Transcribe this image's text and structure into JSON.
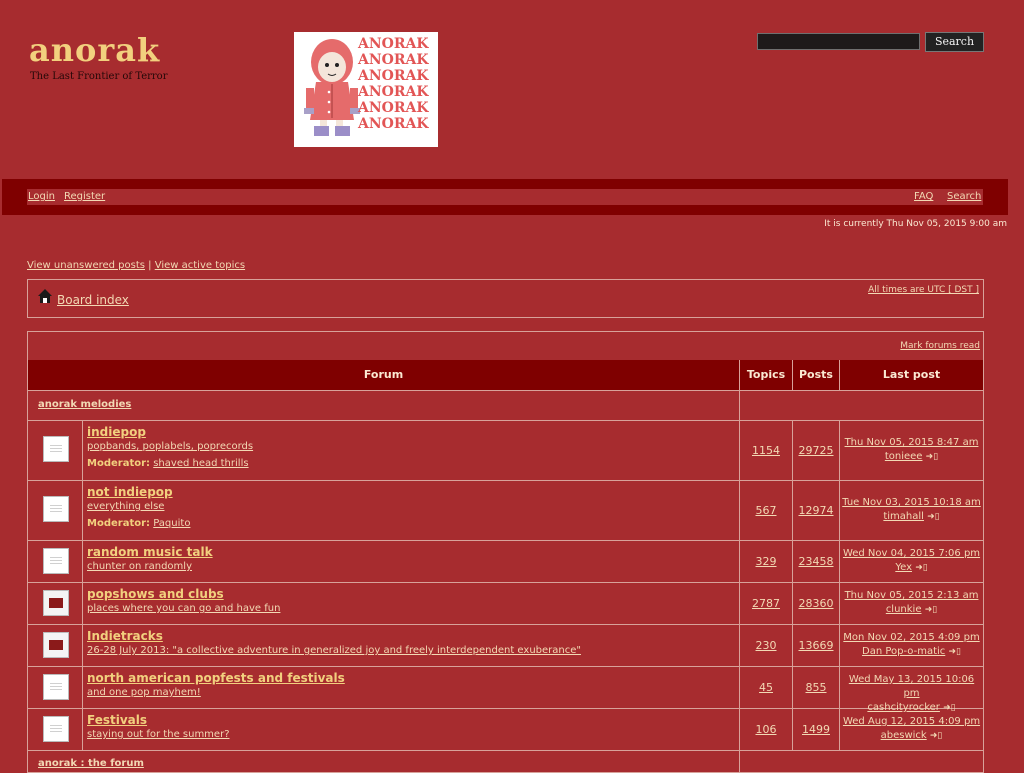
{
  "site": {
    "title": "anorak",
    "description": "The Last Frontier of Terror",
    "logo_text": "ANORAK",
    "search_button": "Search"
  },
  "nav": {
    "login": "Login",
    "register": "Register",
    "faq": "FAQ",
    "search": "Search"
  },
  "current_time": "It is currently Thu Nov 05, 2015 9:00 am",
  "quick_links": {
    "unanswered": "View unanswered posts",
    "sep": "|",
    "active": "View active topics"
  },
  "breadcrumb": {
    "board_index": "Board index",
    "times": "All times are UTC [ DST ]"
  },
  "forum_table": {
    "mark_read": "Mark forums read",
    "headers": [
      "Forum",
      "Topics",
      "Posts",
      "Last post"
    ],
    "category": "anorak melodies",
    "next_category": "anorak : the forum",
    "moderator_label": "Moderator:",
    "rows": [
      {
        "name": "indiepop",
        "desc": "popbands, poplabels, poprecords",
        "moderator": "shaved head thrills",
        "topics": "1154",
        "posts": "29725",
        "last_date": "Thu Nov 05, 2015 8:47 am",
        "last_user": "tonieee",
        "icon": "read"
      },
      {
        "name": "not indiepop",
        "desc": "everything else",
        "moderator": "Paquito",
        "topics": "567",
        "posts": "12974",
        "last_date": "Tue Nov 03, 2015 10:18 am",
        "last_user": "timahall",
        "icon": "read"
      },
      {
        "name": "random music talk",
        "desc": "chunter on randomly",
        "moderator": "",
        "topics": "329",
        "posts": "23458",
        "last_date": "Wed Nov 04, 2015 7:06 pm",
        "last_user": "Yex",
        "icon": "read"
      },
      {
        "name": "popshows and clubs",
        "desc": "places where you can go and have fun",
        "moderator": "",
        "topics": "2787",
        "posts": "28360",
        "last_date": "Thu Nov 05, 2015 2:13 am",
        "last_user": "clunkie",
        "icon": "unread"
      },
      {
        "name": "Indietracks",
        "desc": "26-28 July 2013: \"a collective adventure in generalized joy and freely interdependent exuberance\"",
        "moderator": "",
        "topics": "230",
        "posts": "13669",
        "last_date": "Mon Nov 02, 2015 4:09 pm",
        "last_user": "Dan Pop-o-matic",
        "icon": "unread"
      },
      {
        "name": "north american popfests and festivals",
        "desc": "and one pop mayhem!",
        "moderator": "",
        "topics": "45",
        "posts": "855",
        "last_date": "Wed May 13, 2015 10:06 pm",
        "last_user": "cashcityrocker",
        "icon": "read"
      },
      {
        "name": "Festivals",
        "desc": "staying out for the summer?",
        "moderator": "",
        "topics": "106",
        "posts": "1499",
        "last_date": "Wed Aug 12, 2015 4:09 pm",
        "last_user": "abeswick",
        "icon": "read"
      }
    ]
  },
  "colors": {
    "background": "#a72c2f",
    "dark_bar": "#7f0000",
    "link": "#f3d9b4",
    "title": "#f2d07e"
  }
}
